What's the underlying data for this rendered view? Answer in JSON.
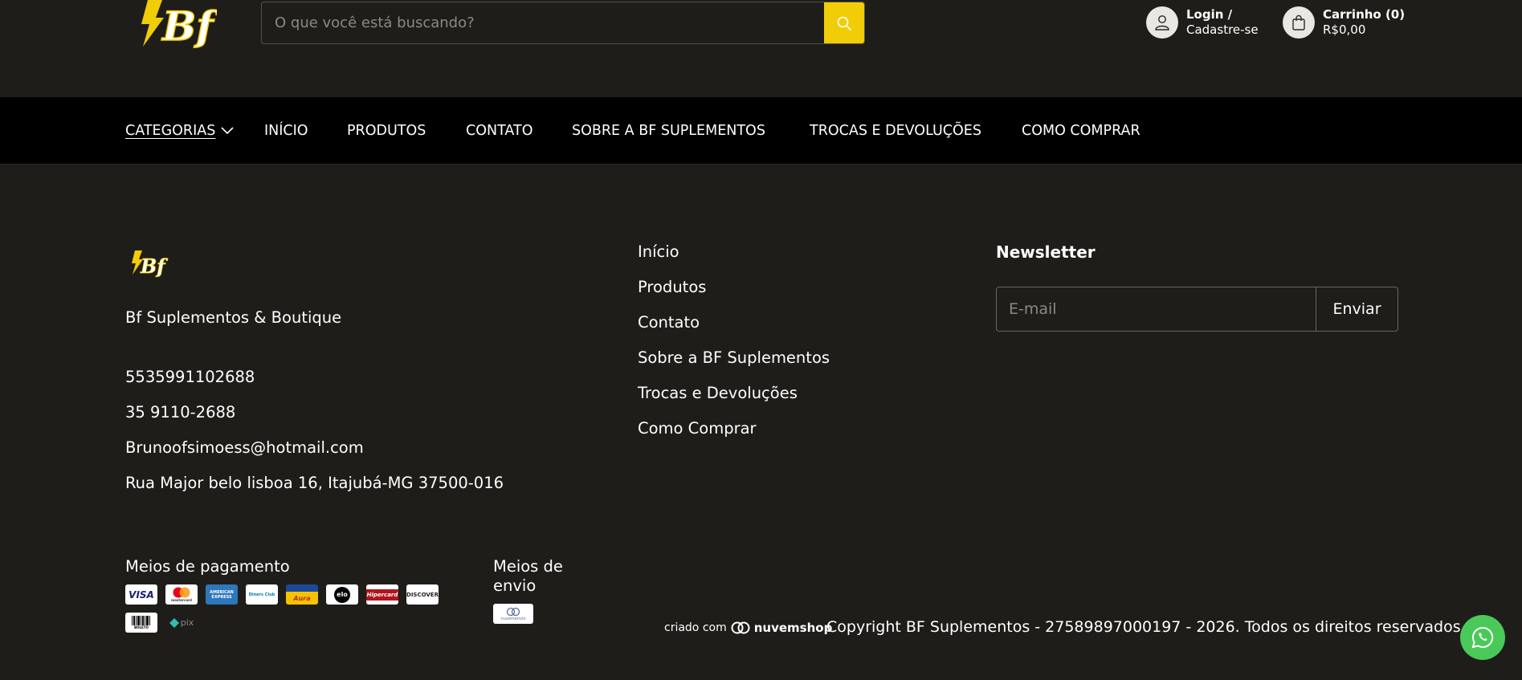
{
  "header": {
    "logo_text": "Bf",
    "search": {
      "placeholder": "O que você está buscando?",
      "value": ""
    },
    "login": {
      "line1": "Login /",
      "line2": "Cadastre-se"
    },
    "cart": {
      "line1": "Carrinho (0)",
      "line2": "R$0,00"
    }
  },
  "nav": {
    "items": [
      {
        "label": "CATEGORIAS"
      },
      {
        "label": "INÍCIO"
      },
      {
        "label": "PRODUTOS"
      },
      {
        "label": "CONTATO"
      },
      {
        "label": "SOBRE A BF SUPLEMENTOS"
      },
      {
        "label": "TROCAS E DEVOLUÇÕES"
      },
      {
        "label": "COMO COMPRAR"
      }
    ]
  },
  "footer": {
    "logo_text": "Bf",
    "store_name": "Bf Suplementos & Boutique",
    "phone1": "5535991102688",
    "phone2": "35 9110-2688",
    "email": "Brunoofsimoess@hotmail.com",
    "address": "Rua Major belo lisboa 16, Itajubá-MG 37500-016",
    "links": [
      {
        "label": "Início"
      },
      {
        "label": "Produtos"
      },
      {
        "label": "Contato"
      },
      {
        "label": "Sobre a BF Suplementos"
      },
      {
        "label": "Trocas e Devoluções"
      },
      {
        "label": "Como Comprar"
      }
    ],
    "newsletter": {
      "title": "Newsletter",
      "placeholder": "E-mail",
      "button": "Enviar"
    },
    "payment_label": "Meios de pagamento",
    "payment_methods": [
      {
        "text": "VISA"
      },
      {
        "text": "mastercard"
      },
      {
        "text": "AMERICAN EXPRESS"
      },
      {
        "text": "Diners Club"
      },
      {
        "text": "Aura"
      },
      {
        "text": "elo"
      },
      {
        "text": "Hipercard"
      },
      {
        "text": "DISCOVER"
      },
      {
        "text": "BOLETO"
      },
      {
        "text": "pix"
      }
    ],
    "shipping_label": "Meios de envio",
    "shipping_method": "nuvemenvio",
    "criado_com": "criado com",
    "platform": "nuvemshop",
    "copyright": "Copyright BF Suplementos - 27589897000197 - 2026. Todos os direitos reservados."
  },
  "colors": {
    "background": "#1f1d1a",
    "nav_background": "#000000",
    "accent_yellow": "#f1cd07",
    "whatsapp_green": "#4ac959"
  },
  "icons": {
    "search": "search-icon",
    "user": "user-icon",
    "cart": "shopping-bag-icon",
    "chevron": "chevron-down-icon",
    "whatsapp": "whatsapp-icon"
  }
}
